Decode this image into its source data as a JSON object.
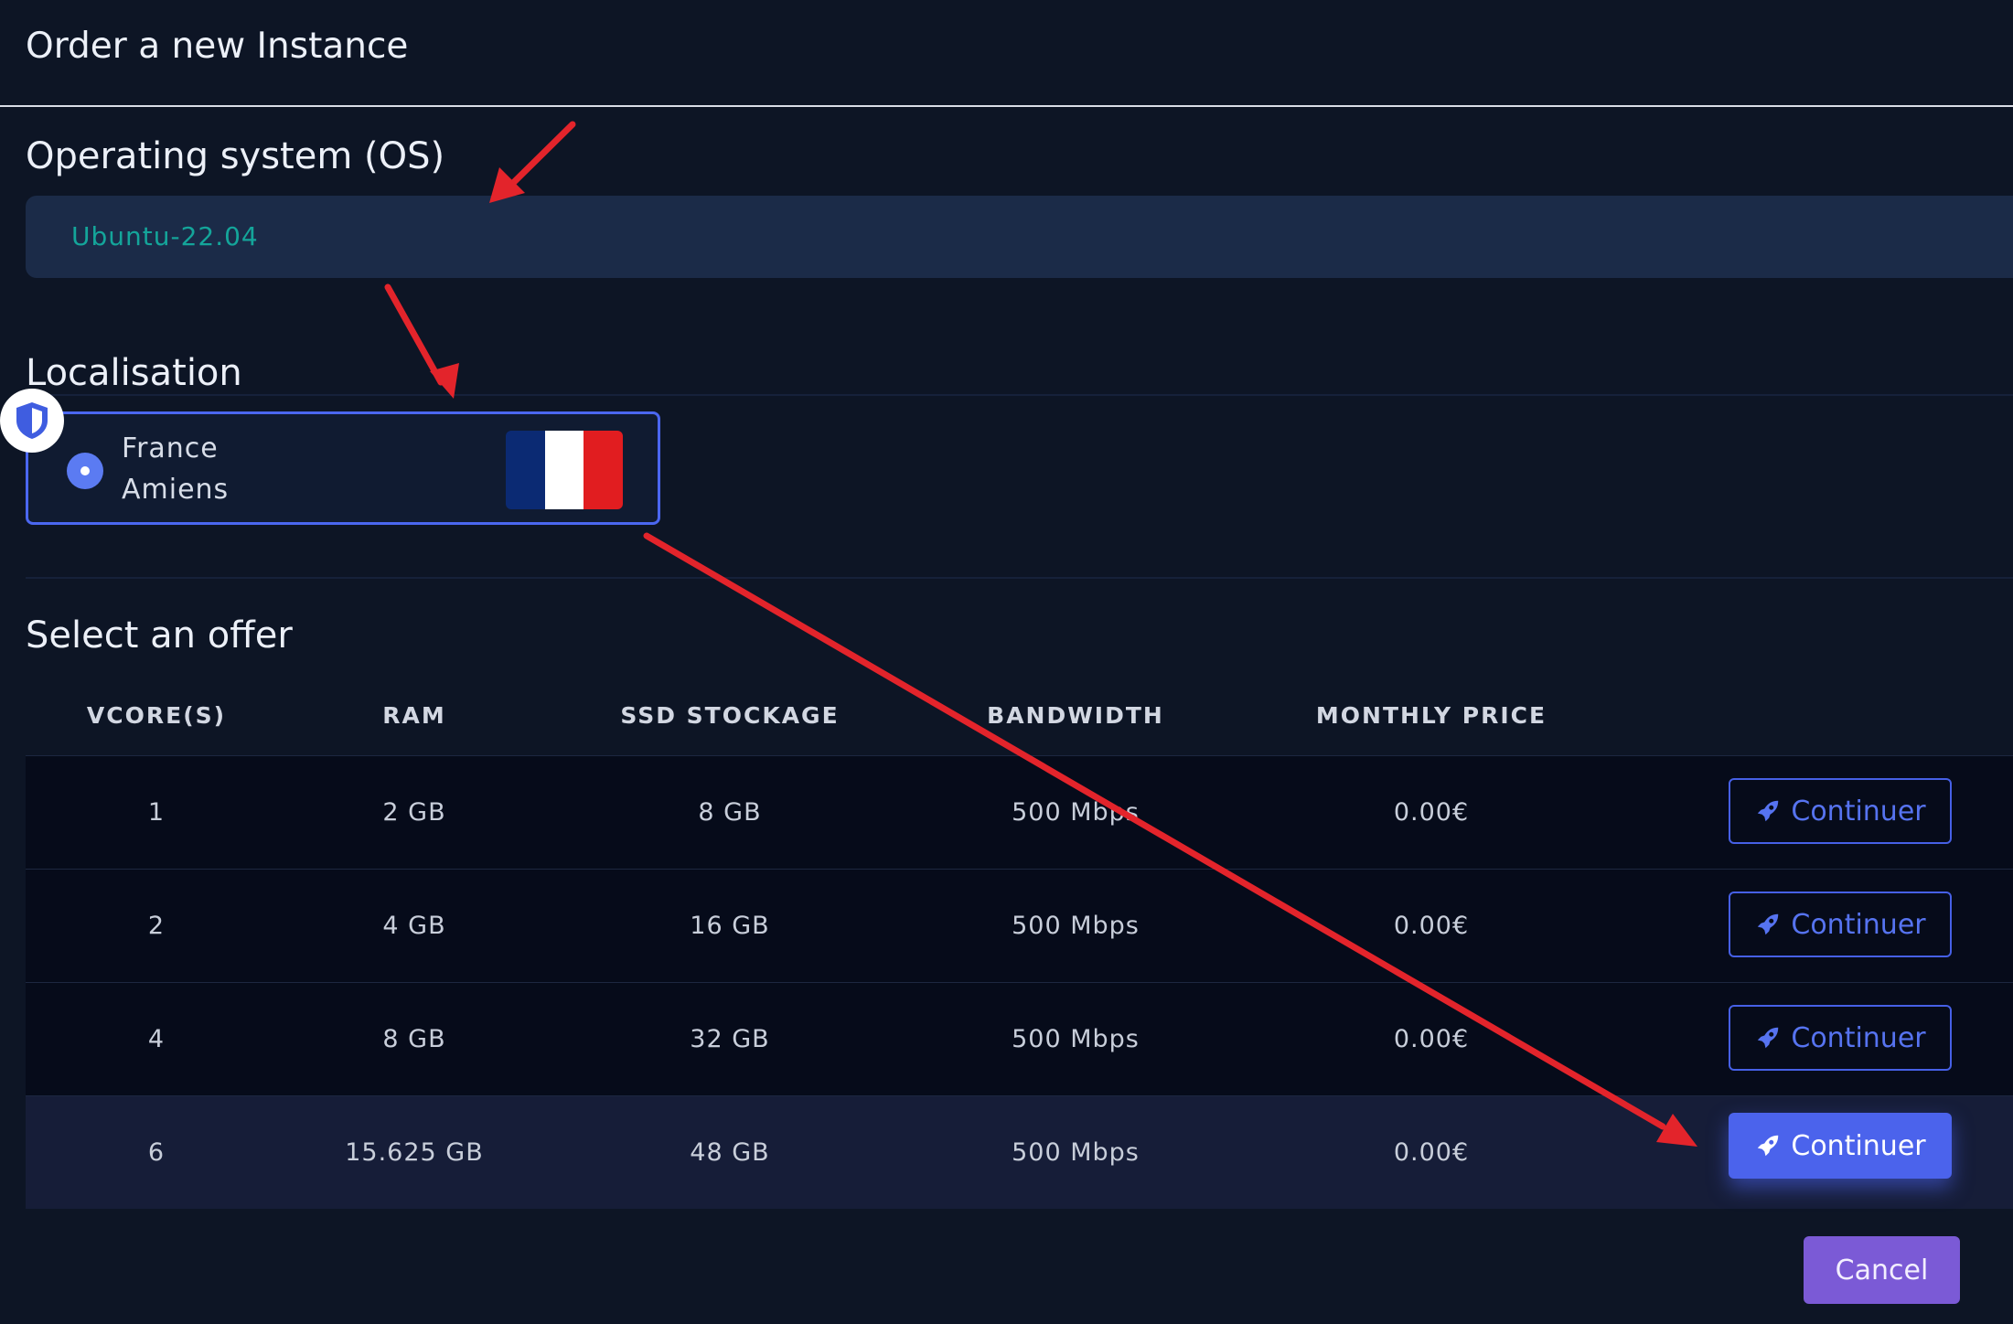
{
  "header": {
    "title": "Order a new Instance"
  },
  "os": {
    "label": "Operating system (OS)",
    "value": "Ubuntu-22.04"
  },
  "localisation": {
    "label": "Localisation",
    "option": {
      "country": "France",
      "city": "Amiens",
      "selected": true,
      "flag_colors": [
        "#0b2a73",
        "#ffffff",
        "#e11d20"
      ]
    }
  },
  "offer": {
    "label": "Select an offer",
    "columns": [
      "VCORE(S)",
      "RAM",
      "SSD STOCKAGE",
      "BANDWIDTH",
      "MONTHLY PRICE"
    ],
    "rows": [
      {
        "vcores": "1",
        "ram": "2 GB",
        "ssd": "8 GB",
        "bandwidth": "500 Mbps",
        "price": "0.00€",
        "action": "Continuer"
      },
      {
        "vcores": "2",
        "ram": "4 GB",
        "ssd": "16 GB",
        "bandwidth": "500 Mbps",
        "price": "0.00€",
        "action": "Continuer"
      },
      {
        "vcores": "4",
        "ram": "8 GB",
        "ssd": "32 GB",
        "bandwidth": "500 Mbps",
        "price": "0.00€",
        "action": "Continuer"
      },
      {
        "vcores": "6",
        "ram": "15.625 GB",
        "ssd": "48 GB",
        "bandwidth": "500 Mbps",
        "price": "0.00€",
        "action": "Continuer"
      }
    ]
  },
  "footer": {
    "cancel_label": "Cancel"
  },
  "colors": {
    "accent": "#4b63ec",
    "cancel": "#7b5ad6",
    "os_text": "#14a59a",
    "annotation_arrow": "#e3242b",
    "background": "#0d1525"
  }
}
